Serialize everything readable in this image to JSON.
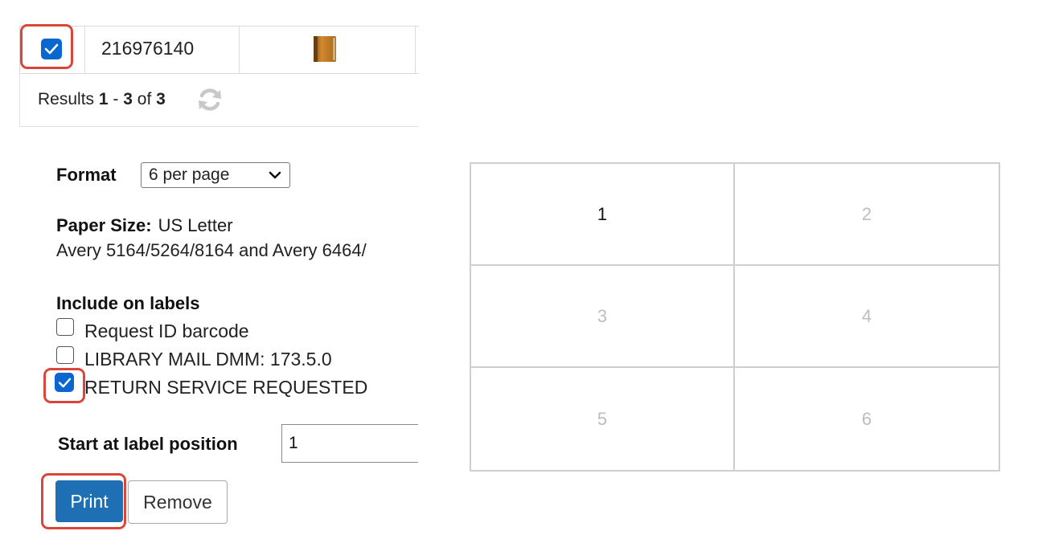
{
  "results_table": {
    "row": {
      "selected": true,
      "request_id": "216976140",
      "format_icon": "book-icon"
    },
    "results_label": "Results",
    "results_from": "1",
    "results_sep": "-",
    "results_to": "3",
    "results_of": "of",
    "results_total": "3",
    "refresh_icon": "refresh-icon"
  },
  "form": {
    "format_label": "Format",
    "format_value": "6 per page",
    "paper_size_label": "Paper Size:",
    "paper_size_value": "US Letter",
    "avery_text": "Avery 5164/5264/8164 and Avery 6464/",
    "include_label": "Include on labels",
    "options": [
      {
        "label": "Request ID barcode",
        "checked": false
      },
      {
        "label": "LIBRARY MAIL DMM: 173.5.0",
        "checked": false
      },
      {
        "label": "RETURN SERVICE REQUESTED",
        "checked": true
      }
    ],
    "start_position_label": "Start at label position",
    "start_position_value": "1",
    "print_label": "Print",
    "remove_label": "Remove"
  },
  "label_grid": {
    "positions": [
      "1",
      "2",
      "3",
      "4",
      "5",
      "6"
    ],
    "active_position": "1"
  },
  "colors": {
    "highlight": "#d9473a",
    "checkbox": "#0b67d0",
    "primary_button": "#1e6fb3"
  }
}
